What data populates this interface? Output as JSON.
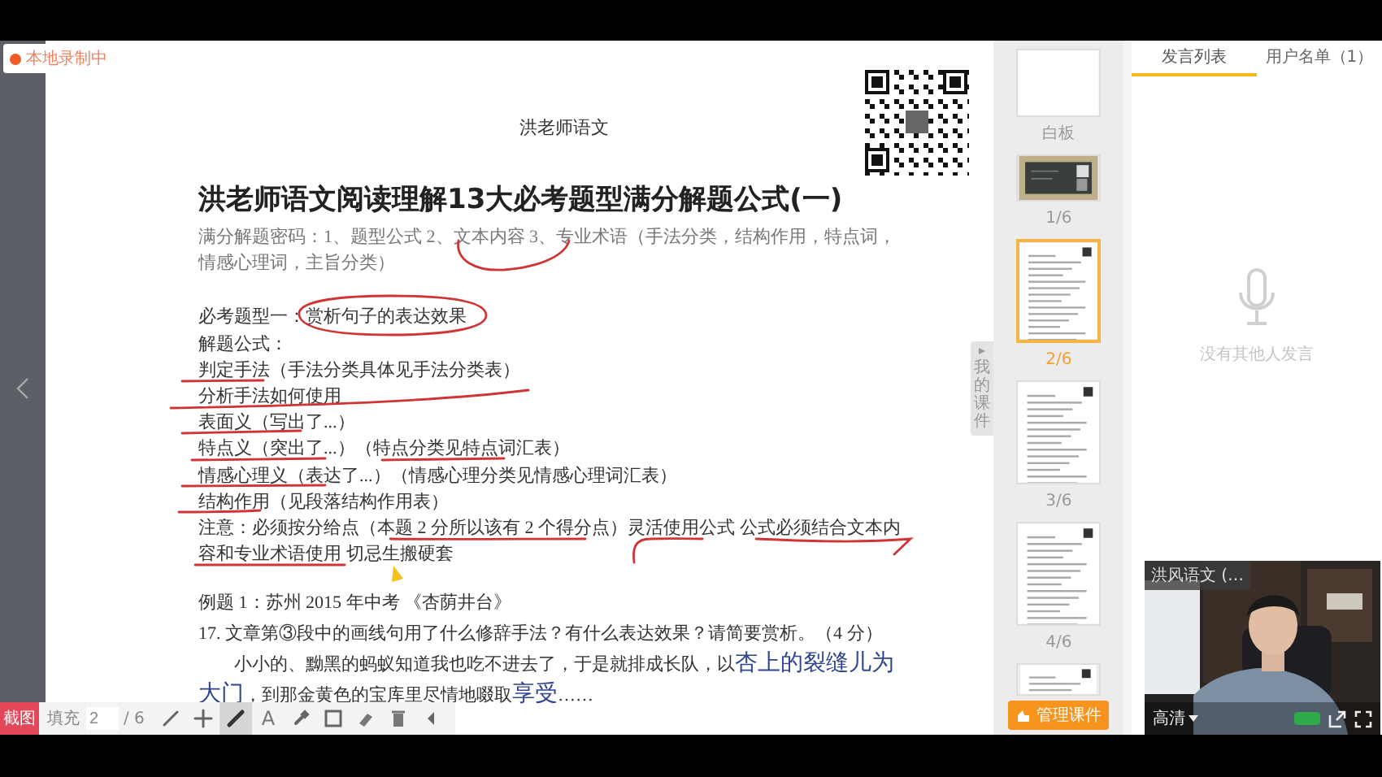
{
  "status": {
    "text": "本地录制中"
  },
  "document": {
    "header": "洪老师语文",
    "title": "洪老师语文阅读理解13大必考题型满分解题公式(一)",
    "blocks": [
      {
        "kind": "intro",
        "lines": [
          [
            {
              "text": "满分解题密码：1、题型公式 2、文本内容 3、专业术语（手法分类，结构作用，特点词，",
              "kind": "print"
            }
          ],
          [
            {
              "text": "情感心理词，主旨分类）",
              "kind": "print"
            }
          ]
        ]
      },
      {
        "kind": "body",
        "lines": [
          [
            {
              "text": "必考题型一：赏析句子的表达效果",
              "kind": "print"
            }
          ],
          [
            {
              "text": "解题公式：",
              "kind": "print"
            }
          ],
          [
            {
              "text": "判定手法（手法分类具体见手法分类表）",
              "kind": "print"
            }
          ],
          [
            {
              "text": "分析手法如何使用",
              "kind": "print"
            }
          ],
          [
            {
              "text": "表面义（写出了...）",
              "kind": "print"
            }
          ],
          [
            {
              "text": "特点义（突出了...）（特点分类见特点词汇表）",
              "kind": "print"
            }
          ],
          [
            {
              "text": "情感心理义（表达了...）（情感心理分类见情感心理词汇表）",
              "kind": "print"
            }
          ],
          [
            {
              "text": "结构作用（见段落结构作用表）",
              "kind": "print"
            }
          ],
          [
            {
              "text": "注意：必须按分给点（本题 2 分所以该有 2 个得分点）灵活使用公式 公式必须结合文本内",
              "kind": "print"
            }
          ],
          [
            {
              "text": "容和专业术语使用 切忌生搬硬套",
              "kind": "print"
            }
          ]
        ]
      },
      {
        "kind": "example",
        "lines": [
          [
            {
              "text": "例题 1：苏州 2015 年中考 《杏荫井台》",
              "kind": "print"
            }
          ],
          [
            {
              "text": "17. 文章第③段中的画线句用了什么修辞手法？有什么表达效果？请简要赏析。（4 分）",
              "kind": "print"
            }
          ],
          [
            {
              "text": "小小的、黝黑的蚂蚁知道我也吃不进去了，于是就排成长队，以",
              "kind": "indent"
            },
            {
              "text": "杏上的裂缝儿为",
              "kind": "hand"
            }
          ],
          [
            {
              "text": "大门",
              "kind": "hand"
            },
            {
              "text": "，到那金黄色的宝库里尽情地啜取",
              "kind": "print"
            },
            {
              "text": "享受",
              "kind": "hand"
            },
            {
              "text": "……",
              "kind": "print"
            }
          ]
        ]
      }
    ]
  },
  "toolbar": {
    "end_button": "截图",
    "page_label": "填充",
    "page_value": "2",
    "page_total": "/ 6",
    "tools": [
      {
        "kind": "pencil",
        "selected": false
      },
      {
        "kind": "move",
        "selected": false
      },
      {
        "kind": "brush",
        "selected": true
      },
      {
        "kind": "text",
        "label": "A",
        "selected": false
      },
      {
        "kind": "marker",
        "selected": false
      },
      {
        "kind": "rect",
        "selected": false
      },
      {
        "kind": "eraser",
        "selected": false
      },
      {
        "kind": "trash",
        "selected": false
      },
      {
        "kind": "collapse",
        "selected": false
      }
    ]
  },
  "side_tab": {
    "label": "我的课件"
  },
  "thumbnails": {
    "items": [
      {
        "kind": "blank",
        "label": "白板",
        "selected": false
      },
      {
        "label": "1/6",
        "selected": false
      },
      {
        "kind": "page",
        "label": "2/6",
        "selected": true
      },
      {
        "kind": "page",
        "label": "3/6",
        "selected": false
      },
      {
        "kind": "page",
        "label": "4/6",
        "selected": false
      },
      {
        "kind": "page",
        "selected": false
      }
    ],
    "manage_button": "管理课件"
  },
  "chat": {
    "tabs": [
      {
        "label": "发言列表",
        "selected": true
      },
      {
        "label": "用户名单（1）",
        "selected": false
      }
    ],
    "empty_text": "没有其他人发言"
  },
  "video": {
    "name": "洪风语文 (…",
    "quality": "高清"
  }
}
